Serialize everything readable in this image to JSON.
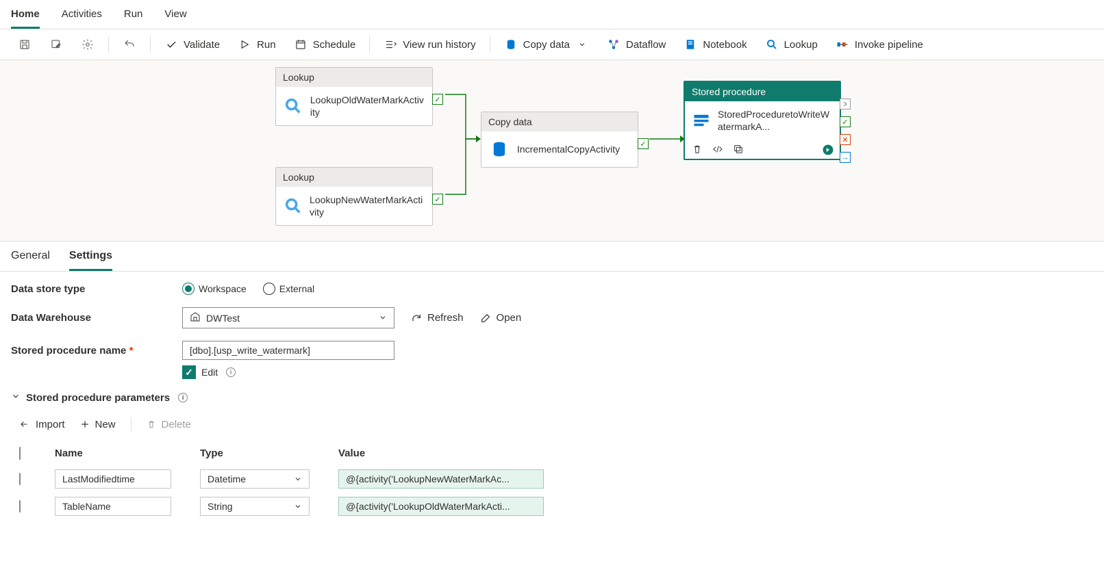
{
  "topTabs": {
    "home": "Home",
    "activities": "Activities",
    "run": "Run",
    "view": "View"
  },
  "toolbar": {
    "validate": "Validate",
    "run": "Run",
    "schedule": "Schedule",
    "viewRunHistory": "View run history",
    "copyData": "Copy data",
    "dataflow": "Dataflow",
    "notebook": "Notebook",
    "lookup": "Lookup",
    "invokePipeline": "Invoke pipeline"
  },
  "canvas": {
    "lookupType": "Lookup",
    "copyDataType": "Copy data",
    "storedProcType": "Stored procedure",
    "act1": "LookupOldWaterMarkActivity",
    "act2": "LookupNewWaterMarkActivity",
    "act3": "IncrementalCopyActivity",
    "act4": "StoredProceduretoWriteWatermarkA..."
  },
  "panelTabs": {
    "general": "General",
    "settings": "Settings"
  },
  "settings": {
    "dataStoreType": "Data store type",
    "workspace": "Workspace",
    "external": "External",
    "dataWarehouse": "Data Warehouse",
    "dwValue": "DWTest",
    "refresh": "Refresh",
    "open": "Open",
    "storedProcName": "Stored procedure name",
    "spValue": "[dbo].[usp_write_watermark]",
    "edit": "Edit",
    "paramsSection": "Stored procedure parameters",
    "import": "Import",
    "new": "New",
    "delete": "Delete",
    "cols": {
      "name": "Name",
      "type": "Type",
      "value": "Value"
    },
    "rows": [
      {
        "name": "LastModifiedtime",
        "type": "Datetime",
        "value": "@{activity('LookupNewWaterMarkAc..."
      },
      {
        "name": "TableName",
        "type": "String",
        "value": "@{activity('LookupOldWaterMarkActi..."
      }
    ]
  }
}
